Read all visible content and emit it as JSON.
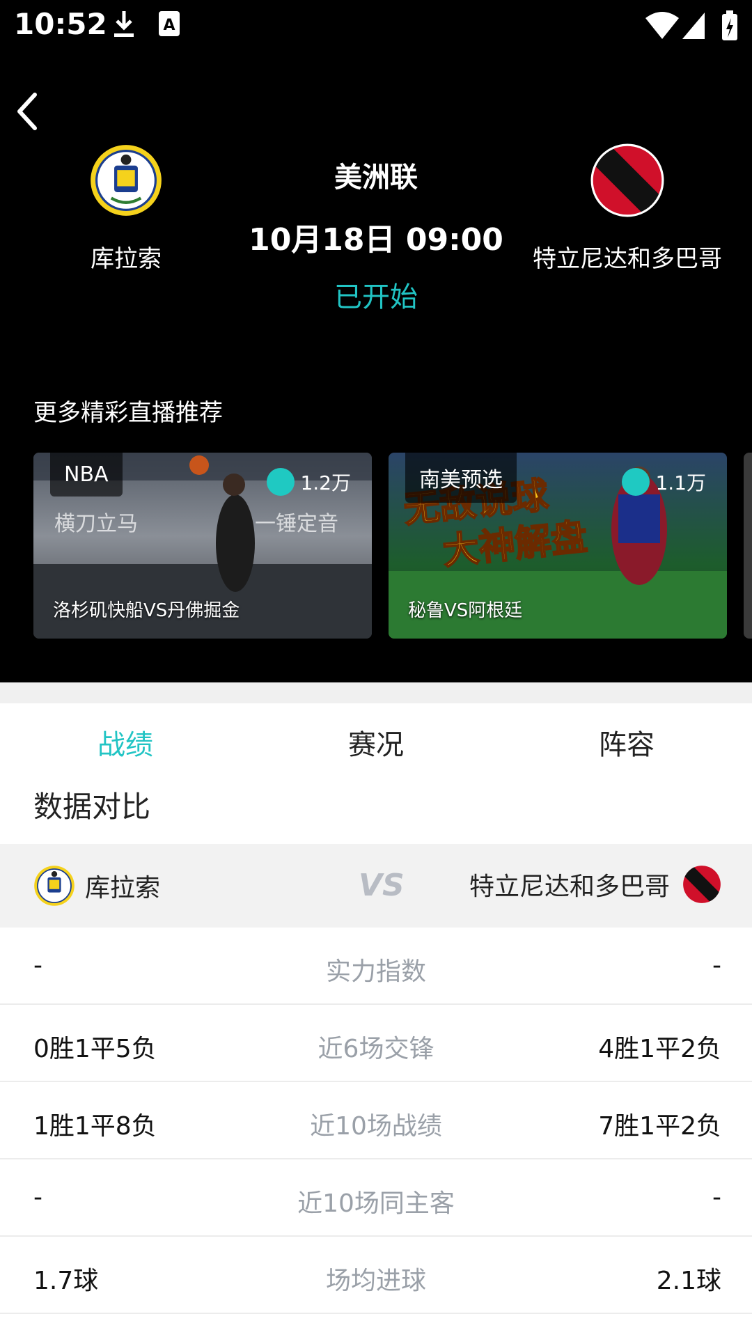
{
  "status_bar": {
    "time": "10:52"
  },
  "match": {
    "league": "美洲联",
    "datetime": "10月18日 09:00",
    "state": "已开始",
    "home": {
      "name": "库拉索"
    },
    "away": {
      "name": "特立尼达和多巴哥"
    }
  },
  "recommend": {
    "title": "更多精彩直播推荐",
    "cards": [
      {
        "tag": "NBA",
        "viewers": "1.2万",
        "title": "洛杉矶快船VS丹佛掘金"
      },
      {
        "tag": "南美预选",
        "viewers": "1.1万",
        "title": "秘鲁VS阿根廷"
      }
    ]
  },
  "tabs": [
    "战绩",
    "赛况",
    "阵容"
  ],
  "active_tab": "战绩",
  "compare": {
    "title": "数据对比",
    "home": "库拉索",
    "vs": "VS",
    "away": "特立尼达和多巴哥",
    "rows": [
      {
        "label": "实力指数",
        "home": "-",
        "away": "-"
      },
      {
        "label": "近6场交锋",
        "home": "0胜1平5负",
        "away": "4胜1平2负"
      },
      {
        "label": "近10场战绩",
        "home": "1胜1平8负",
        "away": "7胜1平2负"
      },
      {
        "label": "近10场同主客",
        "home": "-",
        "away": "-"
      },
      {
        "label": "场均进球",
        "home": "1.7球",
        "away": "2.1球"
      }
    ]
  },
  "colors": {
    "accent": "#21c4c4",
    "header_bg": "#000000"
  },
  "icons": [
    "back-icon",
    "download-icon",
    "notification-a-icon",
    "wifi-icon",
    "signal-icon",
    "battery-icon",
    "viewer-dot-icon"
  ]
}
